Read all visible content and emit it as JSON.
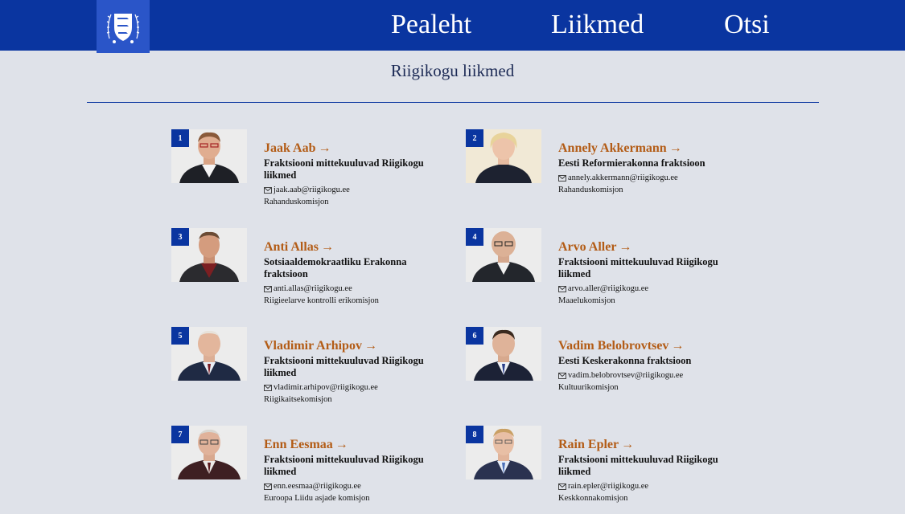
{
  "nav": {
    "home": "Pealeht",
    "members": "Liikmed",
    "search": "Otsi"
  },
  "page_title": "Riigikogu liikmed",
  "members": [
    {
      "num": "1",
      "name": "Jaak Aab",
      "faction": "Fraktsiooni mittekuuluvad Riigikogu liikmed",
      "email": "jaak.aab@riigikogu.ee",
      "committee": "Rahanduskomisjon"
    },
    {
      "num": "2",
      "name": "Annely Akkermann",
      "faction": "Eesti Reformierakonna fraktsioon",
      "email": "annely.akkermann@riigikogu.ee",
      "committee": "Rahanduskomisjon"
    },
    {
      "num": "3",
      "name": "Anti Allas",
      "faction": "Sotsiaaldemokraatliku Erakonna fraktsioon",
      "email": "anti.allas@riigikogu.ee",
      "committee": "Riigieelarve kontrolli erikomisjon"
    },
    {
      "num": "4",
      "name": "Arvo Aller",
      "faction": "Fraktsiooni mittekuuluvad Riigikogu liikmed",
      "email": "arvo.aller@riigikogu.ee",
      "committee": "Maaelukomisjon"
    },
    {
      "num": "5",
      "name": "Vladimir Arhipov",
      "faction": "Fraktsiooni mittekuuluvad Riigikogu liikmed",
      "email": "vladimir.arhipov@riigikogu.ee",
      "committee": "Riigikaitsekomisjon"
    },
    {
      "num": "6",
      "name": "Vadim Belobrovtsev",
      "faction": "Eesti Keskerakonna fraktsioon",
      "email": "vadim.belobrovtsev@riigikogu.ee",
      "committee": "Kultuurikomisjon"
    },
    {
      "num": "7",
      "name": "Enn Eesmaa",
      "faction": "Fraktsiooni mittekuuluvad Riigikogu liikmed",
      "email": "enn.eesmaa@riigikogu.ee",
      "committee": "Euroopa Liidu asjade komisjon"
    },
    {
      "num": "8",
      "name": "Rain Epler",
      "faction": "Fraktsiooni mittekuuluvad Riigikogu liikmed",
      "email": "rain.epler@riigikogu.ee",
      "committee": "Keskkonnakomisjon"
    }
  ],
  "colors": {
    "header": "#0a35a0",
    "name_link": "#b35c16",
    "background": "#dfe2e9"
  },
  "icons": {
    "logo": "estonia-coat-of-arms-icon",
    "email": "envelope-icon",
    "arrow": "arrow-right-icon"
  }
}
